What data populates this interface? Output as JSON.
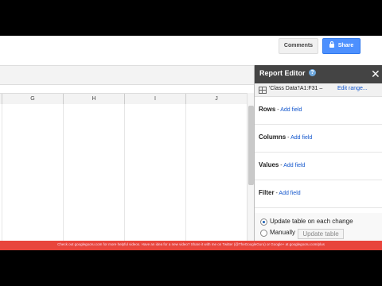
{
  "header": {
    "comments_label": "Comments",
    "share_label": "Share"
  },
  "sheet": {
    "columns": [
      "G",
      "H",
      "I",
      "J"
    ]
  },
  "report_editor": {
    "title": "Report Editor",
    "help_glyph": "?",
    "close_glyph": "✕",
    "range": "'Class Data'!A1:F31",
    "range_separator": " – ",
    "edit_range_label": "Edit range...",
    "sections": [
      {
        "label": "Rows",
        "link": "Add field"
      },
      {
        "label": "Columns",
        "link": "Add field"
      },
      {
        "label": "Values",
        "link": "Add field"
      },
      {
        "label": "Filter",
        "link": "Add field"
      }
    ],
    "section_separator": " - ",
    "update_each_change_label": "Update table on each change",
    "manually_label": "Manually",
    "update_table_button": "Update table",
    "selected_option": "update_each_change"
  },
  "banner": {
    "text": "Check out googlegooru.com for more helpful videos. Have an idea for a new video? Share it with me on Twitter (@TheGoogleGuru) or Google+ at googlegooru.com/plus"
  }
}
